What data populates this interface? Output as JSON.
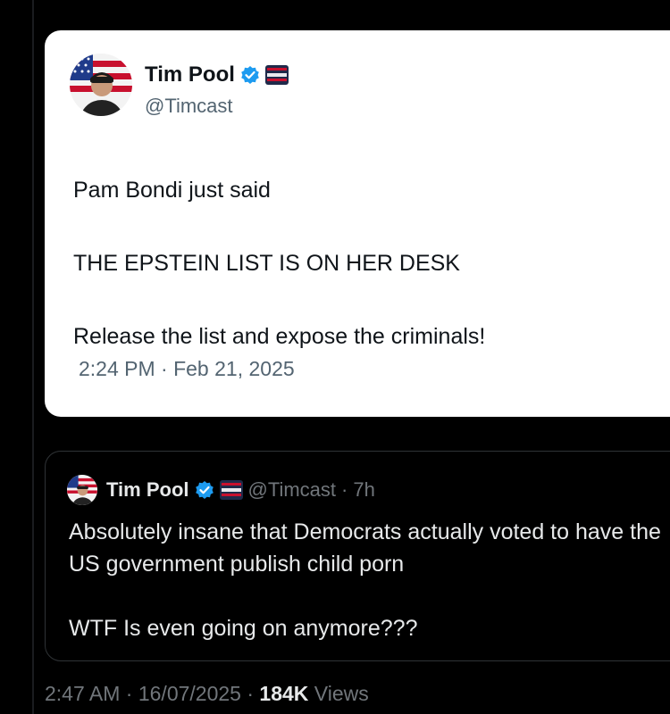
{
  "original_tweet": {
    "author_name": "Tim Pool",
    "handle": "@Timcast",
    "paragraphs": [
      "Pam Bondi just said",
      "THE EPSTEIN LIST IS ON HER DESK",
      "Release the list and expose the criminals!"
    ],
    "timestamp": "2:24 PM · Feb 21, 2025",
    "verified_color": "#1d9bf0"
  },
  "quote_tweet": {
    "author_name": "Tim Pool",
    "handle": "@Timcast",
    "separator": "·",
    "age": "7h",
    "paragraphs": [
      "Absolutely insane that Democrats actually voted to have the US government publish child porn",
      "WTF Is even going on anymore???"
    ]
  },
  "meta": {
    "time": "2:47 AM",
    "sep1": "·",
    "date": "16/07/2025",
    "sep2": "·",
    "views_count": "184K",
    "views_label": "Views"
  },
  "icons": {
    "verified": "verified-badge-icon",
    "affiliate": "timcast-news-affiliate-icon",
    "avatar": "avatar-flag-portrait"
  }
}
